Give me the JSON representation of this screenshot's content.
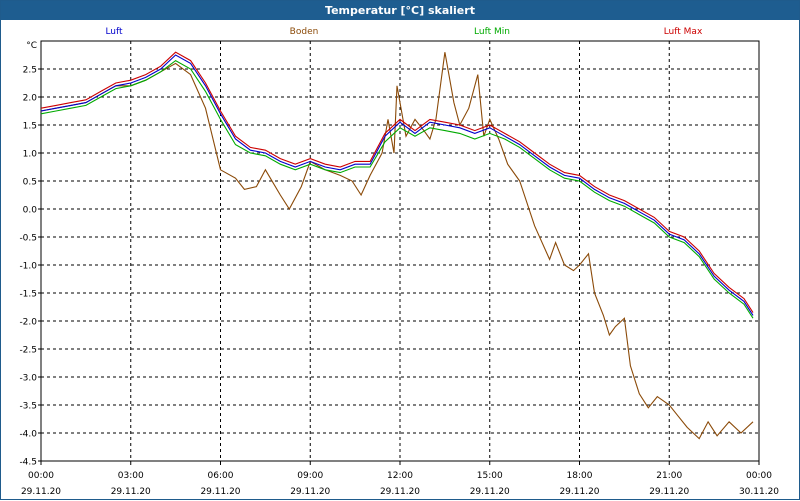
{
  "window": {
    "title": "Temperatur [°C] skaliert"
  },
  "chart_data": {
    "type": "line",
    "title": "Temperatur [°C] skaliert",
    "ylabel": "°C",
    "xlabel": "",
    "grid": true,
    "legend_placement": "top",
    "ylim": [
      -4.5,
      3.0
    ],
    "xlim": [
      0,
      24
    ],
    "x_ticks": [
      {
        "x": 0,
        "time": "00:00",
        "date": "29.11.20"
      },
      {
        "x": 3,
        "time": "03:00",
        "date": "29.11.20"
      },
      {
        "x": 6,
        "time": "06:00",
        "date": "29.11.20"
      },
      {
        "x": 9,
        "time": "09:00",
        "date": "29.11.20"
      },
      {
        "x": 12,
        "time": "12:00",
        "date": "29.11.20"
      },
      {
        "x": 15,
        "time": "15:00",
        "date": "29.11.20"
      },
      {
        "x": 18,
        "time": "18:00",
        "date": "29.11.20"
      },
      {
        "x": 21,
        "time": "21:00",
        "date": "29.11.20"
      },
      {
        "x": 24,
        "time": "00:00",
        "date": "30.11.20"
      }
    ],
    "y_ticks": [
      "-4.5",
      "-4.0",
      "-3.5",
      "-3.0",
      "-2.5",
      "-2.0",
      "-1.5",
      "-1.0",
      "-0.5",
      "0.0",
      "0.5",
      "1.0",
      "1.5",
      "2.0",
      "2.5"
    ],
    "series": [
      {
        "name": "Luft",
        "color": "#0000cc",
        "points": [
          [
            0,
            1.75
          ],
          [
            0.5,
            1.8
          ],
          [
            1,
            1.85
          ],
          [
            1.5,
            1.9
          ],
          [
            2,
            2.05
          ],
          [
            2.5,
            2.2
          ],
          [
            3,
            2.25
          ],
          [
            3.5,
            2.35
          ],
          [
            4,
            2.5
          ],
          [
            4.5,
            2.75
          ],
          [
            5,
            2.6
          ],
          [
            5.5,
            2.2
          ],
          [
            6,
            1.7
          ],
          [
            6.5,
            1.25
          ],
          [
            7,
            1.05
          ],
          [
            7.5,
            1.0
          ],
          [
            8,
            0.85
          ],
          [
            8.5,
            0.75
          ],
          [
            9,
            0.85
          ],
          [
            9.5,
            0.75
          ],
          [
            10,
            0.7
          ],
          [
            10.5,
            0.8
          ],
          [
            11,
            0.8
          ],
          [
            11.5,
            1.3
          ],
          [
            12,
            1.55
          ],
          [
            12.5,
            1.35
          ],
          [
            13,
            1.55
          ],
          [
            13.5,
            1.5
          ],
          [
            14,
            1.45
          ],
          [
            14.5,
            1.35
          ],
          [
            15,
            1.45
          ],
          [
            15.5,
            1.3
          ],
          [
            16,
            1.15
          ],
          [
            16.5,
            0.95
          ],
          [
            17,
            0.75
          ],
          [
            17.5,
            0.6
          ],
          [
            18,
            0.55
          ],
          [
            18.5,
            0.35
          ],
          [
            19,
            0.2
          ],
          [
            19.5,
            0.1
          ],
          [
            20,
            -0.05
          ],
          [
            20.5,
            -0.2
          ],
          [
            21,
            -0.45
          ],
          [
            21.5,
            -0.55
          ],
          [
            22,
            -0.8
          ],
          [
            22.5,
            -1.2
          ],
          [
            23,
            -1.45
          ],
          [
            23.5,
            -1.65
          ],
          [
            23.8,
            -1.9
          ]
        ]
      },
      {
        "name": "Boden",
        "color": "#8b4a08",
        "points": [
          [
            0,
            1.75
          ],
          [
            0.5,
            1.8
          ],
          [
            1,
            1.85
          ],
          [
            1.5,
            1.9
          ],
          [
            2,
            2.05
          ],
          [
            2.5,
            2.2
          ],
          [
            3,
            2.2
          ],
          [
            3.5,
            2.3
          ],
          [
            4,
            2.45
          ],
          [
            4.5,
            2.6
          ],
          [
            5,
            2.4
          ],
          [
            5.5,
            1.8
          ],
          [
            6,
            0.7
          ],
          [
            6.5,
            0.55
          ],
          [
            6.8,
            0.35
          ],
          [
            7.2,
            0.4
          ],
          [
            7.5,
            0.7
          ],
          [
            8,
            0.25
          ],
          [
            8.3,
            0.0
          ],
          [
            8.7,
            0.4
          ],
          [
            9,
            0.85
          ],
          [
            9.5,
            0.7
          ],
          [
            10,
            0.6
          ],
          [
            10.4,
            0.5
          ],
          [
            10.7,
            0.25
          ],
          [
            11,
            0.6
          ],
          [
            11.4,
            1.0
          ],
          [
            11.6,
            1.6
          ],
          [
            11.8,
            1.0
          ],
          [
            11.9,
            2.2
          ],
          [
            12,
            1.9
          ],
          [
            12.2,
            1.3
          ],
          [
            12.5,
            1.6
          ],
          [
            12.8,
            1.4
          ],
          [
            13,
            1.25
          ],
          [
            13.2,
            1.6
          ],
          [
            13.5,
            2.8
          ],
          [
            13.8,
            1.9
          ],
          [
            14,
            1.5
          ],
          [
            14.3,
            1.8
          ],
          [
            14.6,
            2.4
          ],
          [
            14.8,
            1.3
          ],
          [
            15,
            1.6
          ],
          [
            15.3,
            1.25
          ],
          [
            15.6,
            0.8
          ],
          [
            16,
            0.5
          ],
          [
            16.5,
            -0.3
          ],
          [
            17,
            -0.9
          ],
          [
            17.2,
            -0.6
          ],
          [
            17.5,
            -1.0
          ],
          [
            17.8,
            -1.1
          ],
          [
            18,
            -1.0
          ],
          [
            18.3,
            -0.8
          ],
          [
            18.5,
            -1.5
          ],
          [
            18.8,
            -1.9
          ],
          [
            19,
            -2.25
          ],
          [
            19.2,
            -2.1
          ],
          [
            19.5,
            -1.95
          ],
          [
            19.7,
            -2.8
          ],
          [
            20,
            -3.3
          ],
          [
            20.3,
            -3.55
          ],
          [
            20.6,
            -3.35
          ],
          [
            21,
            -3.5
          ],
          [
            21.3,
            -3.7
          ],
          [
            21.6,
            -3.9
          ],
          [
            22,
            -4.1
          ],
          [
            22.3,
            -3.8
          ],
          [
            22.6,
            -4.05
          ],
          [
            23,
            -3.8
          ],
          [
            23.4,
            -4.0
          ],
          [
            23.8,
            -3.8
          ]
        ]
      },
      {
        "name": "Luft Min",
        "color": "#00aa00",
        "points": [
          [
            0,
            1.7
          ],
          [
            0.5,
            1.75
          ],
          [
            1,
            1.8
          ],
          [
            1.5,
            1.85
          ],
          [
            2,
            2.0
          ],
          [
            2.5,
            2.15
          ],
          [
            3,
            2.2
          ],
          [
            3.5,
            2.3
          ],
          [
            4,
            2.45
          ],
          [
            4.5,
            2.65
          ],
          [
            5,
            2.5
          ],
          [
            5.5,
            2.1
          ],
          [
            6,
            1.6
          ],
          [
            6.5,
            1.15
          ],
          [
            7,
            1.0
          ],
          [
            7.5,
            0.95
          ],
          [
            8,
            0.8
          ],
          [
            8.5,
            0.7
          ],
          [
            9,
            0.8
          ],
          [
            9.5,
            0.7
          ],
          [
            10,
            0.65
          ],
          [
            10.5,
            0.75
          ],
          [
            11,
            0.75
          ],
          [
            11.5,
            1.2
          ],
          [
            12,
            1.45
          ],
          [
            12.5,
            1.3
          ],
          [
            13,
            1.45
          ],
          [
            13.5,
            1.4
          ],
          [
            14,
            1.35
          ],
          [
            14.5,
            1.25
          ],
          [
            15,
            1.35
          ],
          [
            15.5,
            1.25
          ],
          [
            16,
            1.1
          ],
          [
            16.5,
            0.9
          ],
          [
            17,
            0.7
          ],
          [
            17.5,
            0.55
          ],
          [
            18,
            0.5
          ],
          [
            18.5,
            0.3
          ],
          [
            19,
            0.15
          ],
          [
            19.5,
            0.05
          ],
          [
            20,
            -0.1
          ],
          [
            20.5,
            -0.25
          ],
          [
            21,
            -0.5
          ],
          [
            21.5,
            -0.6
          ],
          [
            22,
            -0.85
          ],
          [
            22.5,
            -1.25
          ],
          [
            23,
            -1.5
          ],
          [
            23.5,
            -1.7
          ],
          [
            23.8,
            -1.95
          ]
        ]
      },
      {
        "name": "Luft Max",
        "color": "#cc0000",
        "points": [
          [
            0,
            1.8
          ],
          [
            0.5,
            1.85
          ],
          [
            1,
            1.9
          ],
          [
            1.5,
            1.95
          ],
          [
            2,
            2.1
          ],
          [
            2.5,
            2.25
          ],
          [
            3,
            2.3
          ],
          [
            3.5,
            2.4
          ],
          [
            4,
            2.55
          ],
          [
            4.5,
            2.8
          ],
          [
            5,
            2.65
          ],
          [
            5.5,
            2.25
          ],
          [
            6,
            1.75
          ],
          [
            6.5,
            1.3
          ],
          [
            7,
            1.1
          ],
          [
            7.5,
            1.05
          ],
          [
            8,
            0.9
          ],
          [
            8.5,
            0.8
          ],
          [
            9,
            0.9
          ],
          [
            9.5,
            0.8
          ],
          [
            10,
            0.75
          ],
          [
            10.5,
            0.85
          ],
          [
            11,
            0.85
          ],
          [
            11.5,
            1.35
          ],
          [
            12,
            1.6
          ],
          [
            12.5,
            1.4
          ],
          [
            13,
            1.6
          ],
          [
            13.5,
            1.55
          ],
          [
            14,
            1.5
          ],
          [
            14.5,
            1.4
          ],
          [
            15,
            1.5
          ],
          [
            15.5,
            1.35
          ],
          [
            16,
            1.2
          ],
          [
            16.5,
            1.0
          ],
          [
            17,
            0.8
          ],
          [
            17.5,
            0.65
          ],
          [
            18,
            0.6
          ],
          [
            18.5,
            0.4
          ],
          [
            19,
            0.25
          ],
          [
            19.5,
            0.15
          ],
          [
            20,
            0.0
          ],
          [
            20.5,
            -0.15
          ],
          [
            21,
            -0.4
          ],
          [
            21.5,
            -0.5
          ],
          [
            22,
            -0.75
          ],
          [
            22.5,
            -1.15
          ],
          [
            23,
            -1.4
          ],
          [
            23.5,
            -1.6
          ],
          [
            23.8,
            -1.85
          ]
        ]
      }
    ]
  }
}
